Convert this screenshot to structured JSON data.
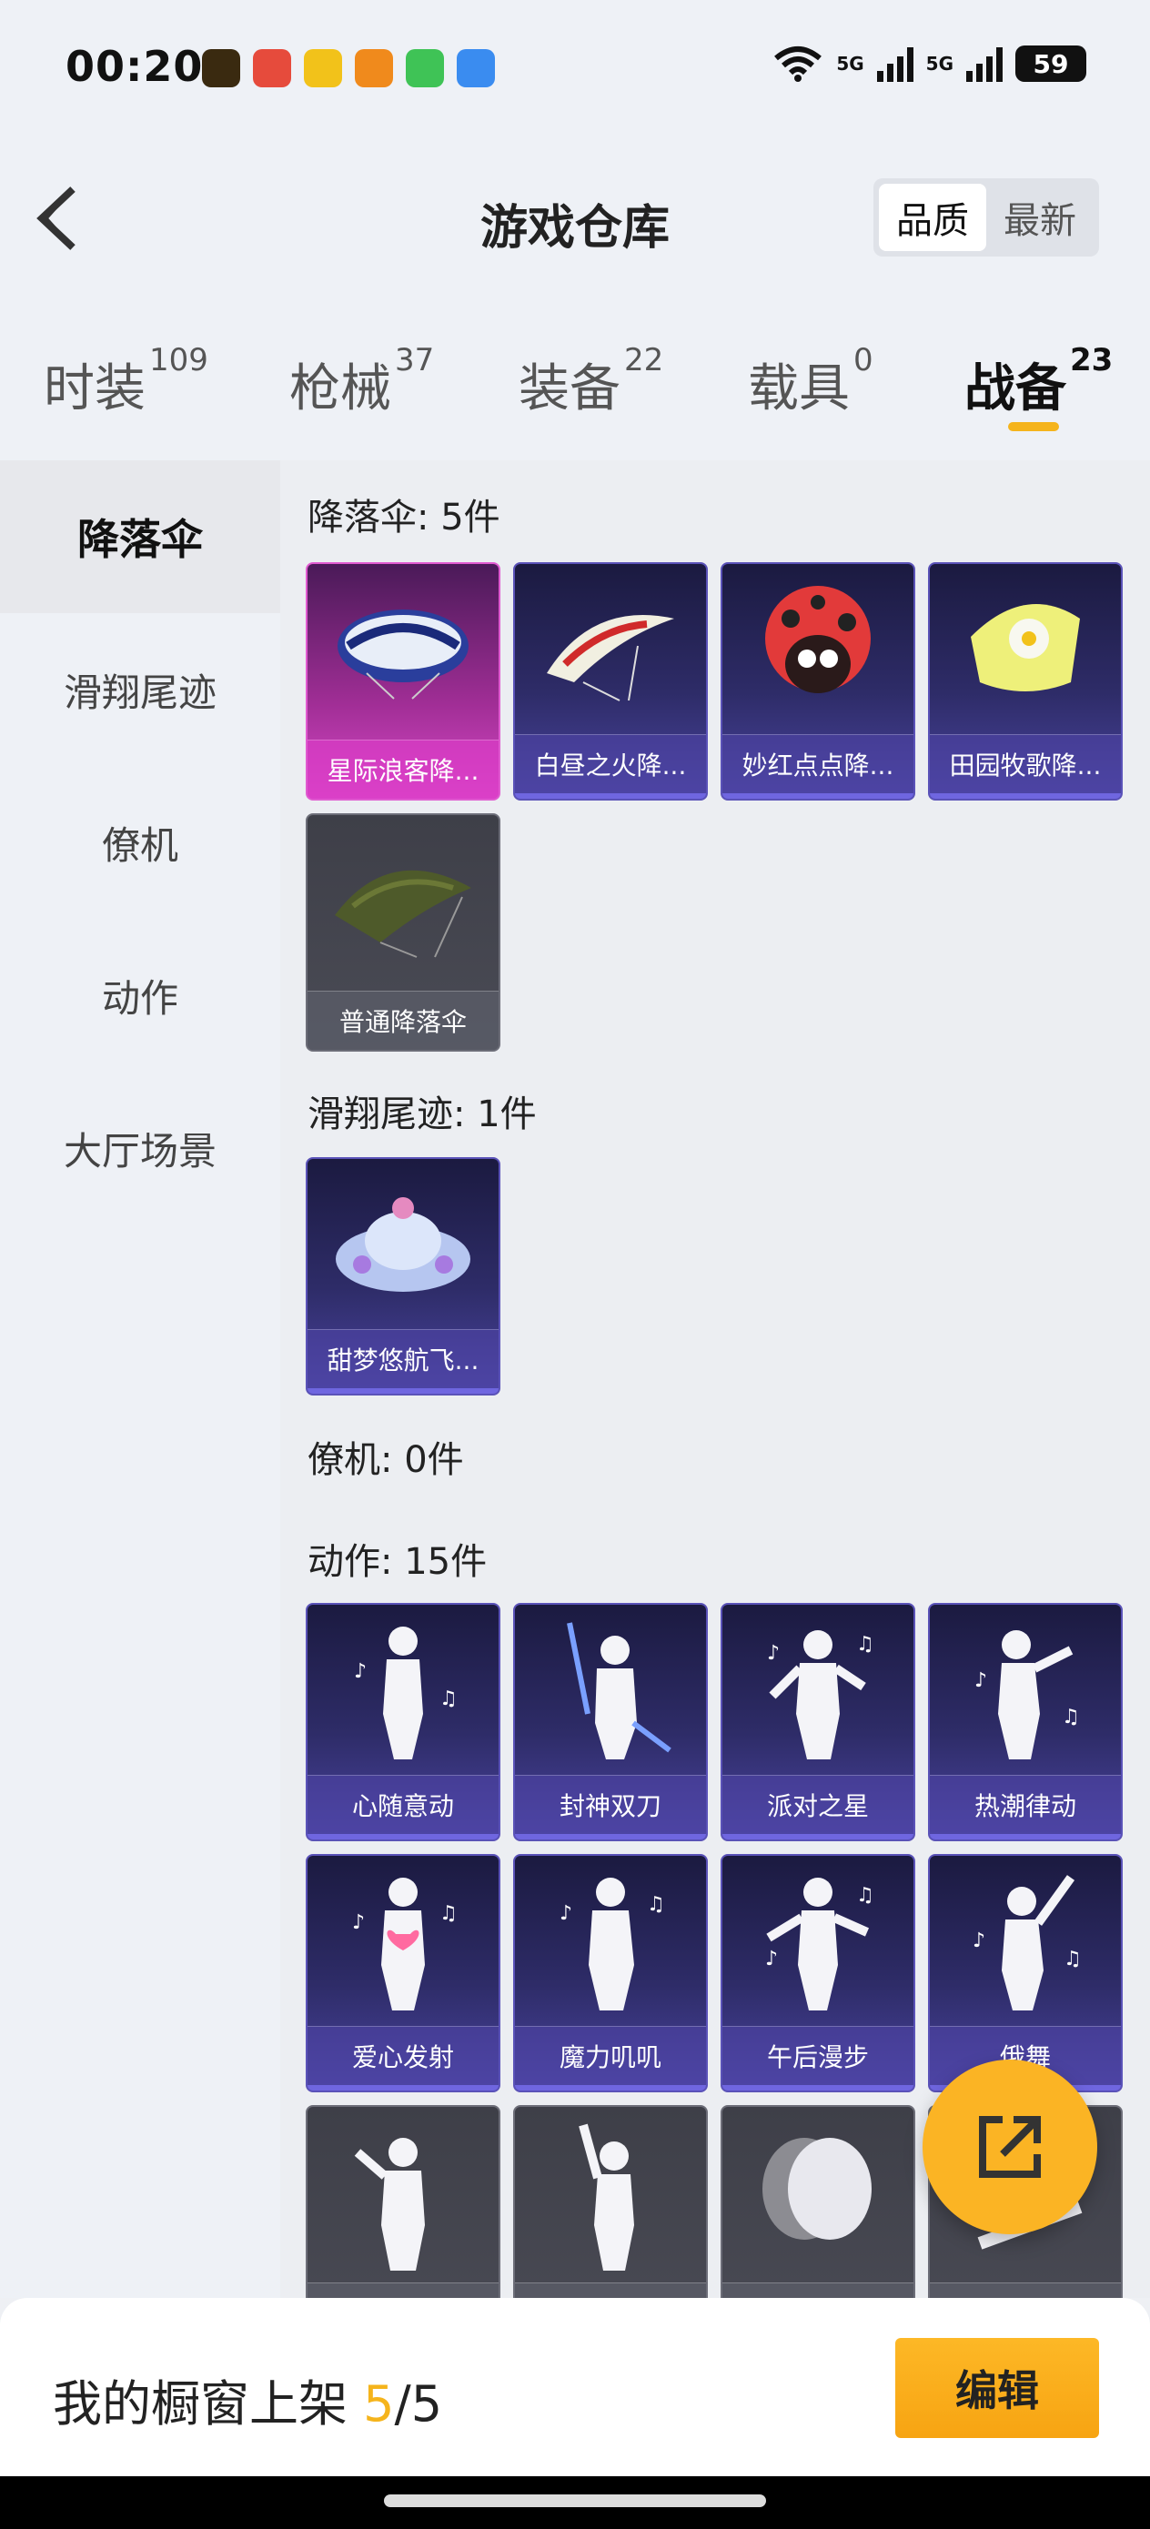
{
  "status": {
    "time": "00:20",
    "network1": "5G",
    "network2": "5G",
    "battery": "59"
  },
  "header": {
    "title": "游戏仓库",
    "sort_quality": "品质",
    "sort_latest": "最新"
  },
  "tabs": [
    {
      "label": "时装",
      "count": "109"
    },
    {
      "label": "枪械",
      "count": "37"
    },
    {
      "label": "装备",
      "count": "22"
    },
    {
      "label": "载具",
      "count": "0"
    },
    {
      "label": "战备",
      "count": "23"
    }
  ],
  "sidebar": [
    "降落伞",
    "滑翔尾迹",
    "僚机",
    "动作",
    "大厅场景"
  ],
  "sections": {
    "parachute": {
      "title": "降落伞: 5件",
      "items": [
        "星际浪客降...",
        "白昼之火降...",
        "妙红点点降...",
        "田园牧歌降...",
        "普通降落伞"
      ]
    },
    "trail": {
      "title": "滑翔尾迹: 1件",
      "items": [
        "甜梦悠航飞..."
      ]
    },
    "wingman": {
      "title": "僚机: 0件"
    },
    "emote": {
      "title": "动作: 15件",
      "items": [
        "心随意动",
        "封神双刀",
        "派对之星",
        "热潮律动",
        "爱心发射",
        "魔力叽叽",
        "午后漫步",
        "俄舞"
      ]
    }
  },
  "bottom": {
    "window_prefix": "我的橱窗上架 ",
    "window_current": "5",
    "window_total": "/5",
    "edit": "编辑"
  },
  "colors": {
    "accent": "#f5b41c",
    "purple_card": "#2e2c68",
    "pink_card": "#d84ac8"
  }
}
